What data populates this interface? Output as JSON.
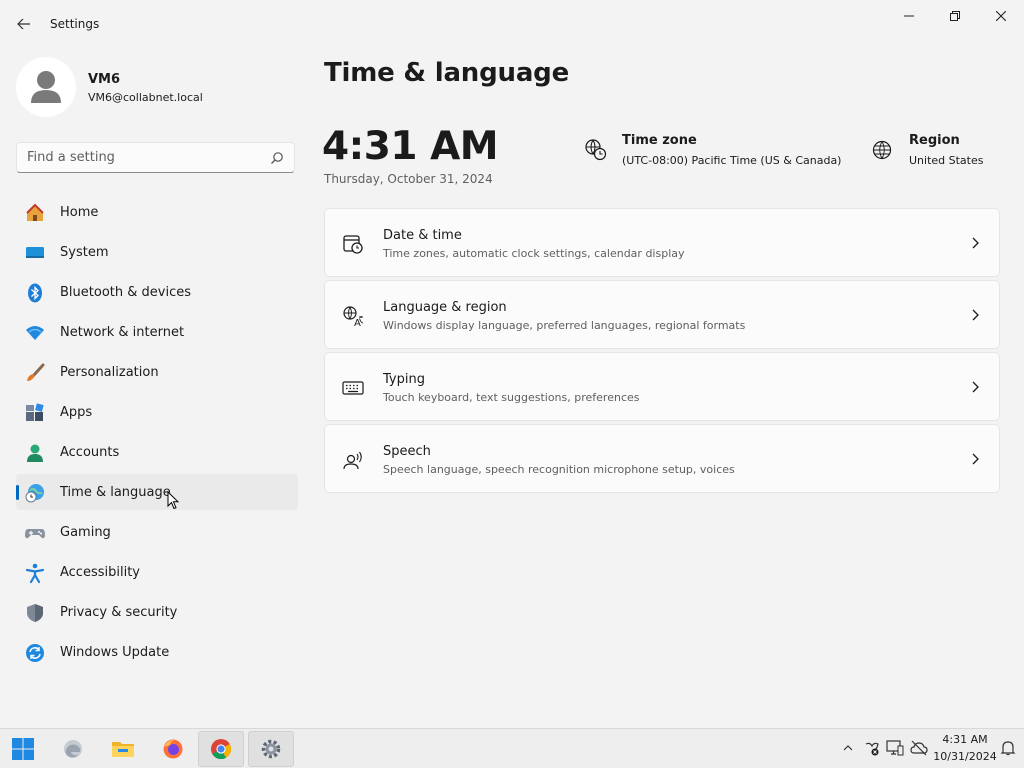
{
  "window": {
    "title": "Settings",
    "back_icon": "back-arrow-icon",
    "controls": [
      "minimize",
      "restore",
      "close"
    ]
  },
  "user": {
    "name": "VM6",
    "email": "VM6@collabnet.local"
  },
  "search": {
    "placeholder": "Find a setting",
    "value": ""
  },
  "sidebar": {
    "items": [
      {
        "label": "Home",
        "icon": "home-icon"
      },
      {
        "label": "System",
        "icon": "system-icon"
      },
      {
        "label": "Bluetooth & devices",
        "icon": "bluetooth-icon"
      },
      {
        "label": "Network & internet",
        "icon": "network-icon"
      },
      {
        "label": "Personalization",
        "icon": "brush-icon"
      },
      {
        "label": "Apps",
        "icon": "apps-icon"
      },
      {
        "label": "Accounts",
        "icon": "accounts-icon"
      },
      {
        "label": "Time & language",
        "icon": "time-language-icon",
        "selected": true
      },
      {
        "label": "Gaming",
        "icon": "gamepad-icon"
      },
      {
        "label": "Accessibility",
        "icon": "accessibility-icon"
      },
      {
        "label": "Privacy & security",
        "icon": "shield-icon"
      },
      {
        "label": "Windows Update",
        "icon": "update-icon"
      }
    ]
  },
  "main": {
    "title": "Time & language",
    "clock": {
      "time": "4:31 AM",
      "date": "Thursday, October 31, 2024"
    },
    "time_zone": {
      "title": "Time zone",
      "value": "(UTC-08:00) Pacific Time (US & Canada)"
    },
    "region": {
      "title": "Region",
      "value": "United States"
    },
    "cards": [
      {
        "title": "Date & time",
        "subtitle": "Time zones, automatic clock settings, calendar display",
        "icon": "calendar-clock-icon"
      },
      {
        "title": "Language & region",
        "subtitle": "Windows display language, preferred languages, regional formats",
        "icon": "language-icon"
      },
      {
        "title": "Typing",
        "subtitle": "Touch keyboard, text suggestions, preferences",
        "icon": "keyboard-icon"
      },
      {
        "title": "Speech",
        "subtitle": "Speech language, speech recognition microphone setup, voices",
        "icon": "speech-icon"
      }
    ]
  },
  "taskbar": {
    "apps": [
      "start",
      "edge",
      "file-explorer",
      "firefox",
      "chrome",
      "settings"
    ],
    "tray": {
      "time": "4:31 AM",
      "date": "10/31/2024"
    }
  },
  "colors": {
    "accent": "#0067c0",
    "background": "#f3f3f3",
    "card": "#fbfbfb"
  }
}
